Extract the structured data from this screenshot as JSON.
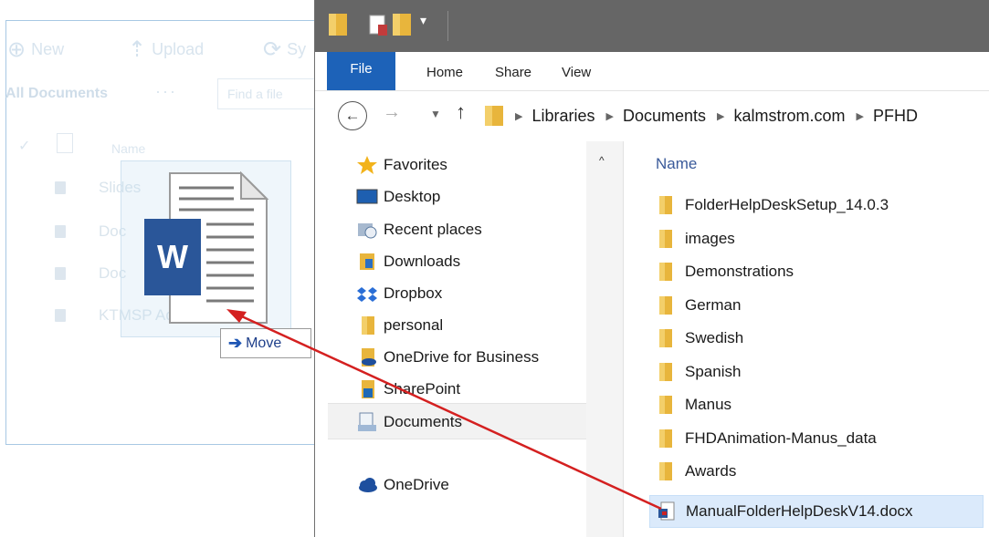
{
  "sharepoint": {
    "commands": [
      {
        "label": "New",
        "icon": "plus-circle-icon"
      },
      {
        "label": "Upload",
        "icon": "upload-icon"
      },
      {
        "label": "Sy",
        "icon": "sync-icon"
      }
    ],
    "view_title": "All Documents",
    "more": "···",
    "find_placeholder": "Find a file",
    "column_name": "Name",
    "rows": [
      "Slides",
      "Doc",
      "Doc",
      "KTMSP Add Manual"
    ]
  },
  "drag": {
    "icon": "word-document-icon",
    "word_letter": "W",
    "tooltip": "Move",
    "tooltip_icon": "right-arrow-icon"
  },
  "explorer": {
    "ribbon": {
      "file_tab": "File",
      "tabs": [
        "Home",
        "Share",
        "View"
      ]
    },
    "breadcrumb": [
      "Libraries",
      "Documents",
      "kalmstrom.com",
      "PFHD"
    ],
    "nav_pane": [
      {
        "label": "Favorites",
        "icon": "star-icon"
      },
      {
        "label": "Desktop",
        "icon": "desktop-icon"
      },
      {
        "label": "Recent places",
        "icon": "recent-places-icon"
      },
      {
        "label": "Downloads",
        "icon": "downloads-folder-icon"
      },
      {
        "label": "Dropbox",
        "icon": "dropbox-icon"
      },
      {
        "label": "personal",
        "icon": "folder-icon"
      },
      {
        "label": "OneDrive for Business",
        "icon": "onedrive-business-folder-icon"
      },
      {
        "label": "SharePoint",
        "icon": "sharepoint-folder-icon"
      },
      {
        "label": "Documents",
        "icon": "documents-icon"
      },
      {
        "label": "OneDrive",
        "icon": "onedrive-cloud-icon"
      }
    ],
    "content": {
      "column_name": "Name",
      "items": [
        {
          "name": "FolderHelpDeskSetup_14.0.3",
          "type": "folder"
        },
        {
          "name": "images",
          "type": "folder"
        },
        {
          "name": "Demonstrations",
          "type": "folder"
        },
        {
          "name": "German",
          "type": "folder"
        },
        {
          "name": "Swedish",
          "type": "folder"
        },
        {
          "name": "Spanish",
          "type": "folder"
        },
        {
          "name": "Manus",
          "type": "folder"
        },
        {
          "name": "FHDAnimation-Manus_data",
          "type": "folder"
        },
        {
          "name": "Awards",
          "type": "folder"
        },
        {
          "name": "ManualFolderHelpDeskV14.docx",
          "type": "docx",
          "selected": true
        }
      ]
    }
  },
  "colors": {
    "file_tab": "#1d62b8",
    "folder": "#e8b53c",
    "arrow": "#d42020",
    "selection": "#dbeafb"
  }
}
